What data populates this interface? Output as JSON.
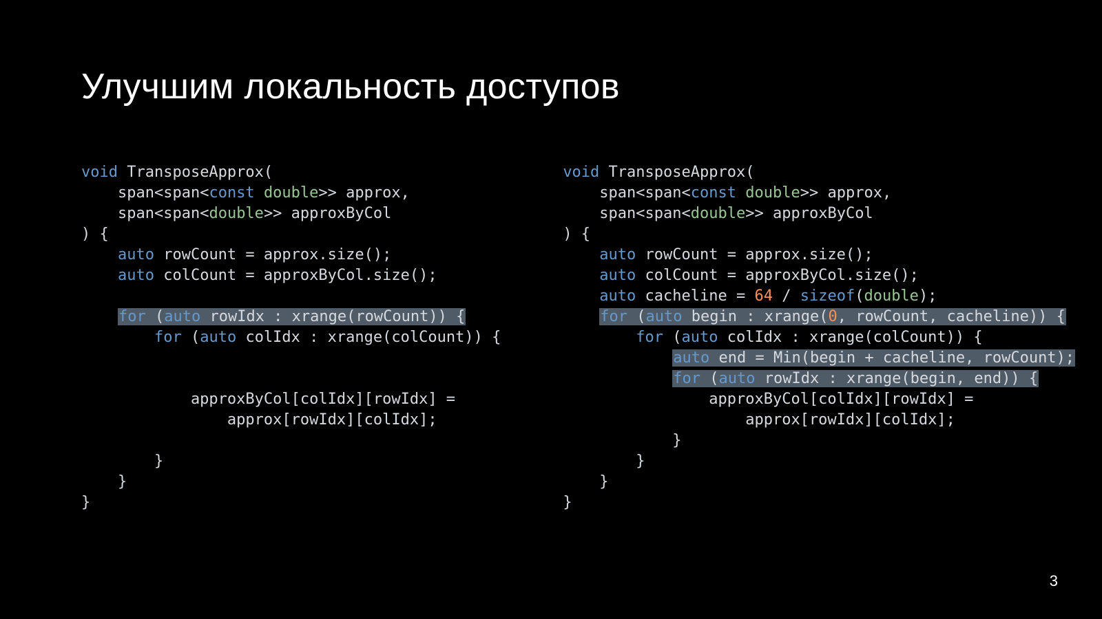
{
  "title": "Улучшим локальность доступов",
  "page_number": "3",
  "left_code": {
    "l1": {
      "a": "void",
      "b": " TransposeApprox("
    },
    "l2": {
      "a": "    span",
      "b": "<",
      "c": "span",
      "d": "<",
      "e": "const",
      "f": " ",
      "g": "double",
      "h": ">> approx,"
    },
    "l3": {
      "a": "    span",
      "b": "<",
      "c": "span",
      "d": "<",
      "e": "double",
      "f": ">> approxByCol"
    },
    "l4": ") {",
    "l5": {
      "a": "    ",
      "b": "auto",
      "c": " rowCount = approx.size();"
    },
    "l6": {
      "a": "    ",
      "b": "auto",
      "c": " colCount = approxByCol.size();"
    },
    "l7": "",
    "l8": {
      "a": "    ",
      "hl_b": "for",
      "hl_c": " (",
      "hl_d": "auto",
      "hl_e": " rowIdx : xrange(rowCount)) {"
    },
    "l9": {
      "a": "        ",
      "b": "for",
      "c": " (",
      "d": "auto",
      "e": " colIdx : xrange(colCount)) {"
    },
    "l10": "",
    "l11": "",
    "l12": "            approxByCol[colIdx][rowIdx] =",
    "l13": "                approx[rowIdx][colIdx];",
    "l14": "",
    "l15": "        }",
    "l16": "    }",
    "l17": "}"
  },
  "right_code": {
    "l1": {
      "a": "void",
      "b": " TransposeApprox("
    },
    "l2": {
      "a": "    span",
      "b": "<",
      "c": "span",
      "d": "<",
      "e": "const",
      "f": " ",
      "g": "double",
      "h": ">> approx,"
    },
    "l3": {
      "a": "    span",
      "b": "<",
      "c": "span",
      "d": "<",
      "e": "double",
      "f": ">> approxByCol"
    },
    "l4": ") {",
    "l5": {
      "a": "    ",
      "b": "auto",
      "c": " rowCount = approx.size();"
    },
    "l6": {
      "a": "    ",
      "b": "auto",
      "c": " colCount = approxByCol.size();"
    },
    "l7": {
      "a": "    ",
      "b": "auto",
      "c": " cacheline = ",
      "d": "64",
      "e": " / ",
      "f": "sizeof",
      "g": "(",
      "h": "double",
      "i": ");"
    },
    "l8": {
      "a": "    ",
      "hl_b": "for",
      "hl_c": " (",
      "hl_d": "auto",
      "hl_e": " begin : xrange(",
      "hl_f": "0",
      "hl_g": ", rowCount, cacheline)) {"
    },
    "l9": {
      "a": "        ",
      "b": "for",
      "c": " (",
      "d": "auto",
      "e": " colIdx : xrange(colCount)) {"
    },
    "l10": {
      "a": "            ",
      "hl_b": "auto",
      "hl_c": " end = Min(begin + cacheline, rowCount);"
    },
    "l11": {
      "a": "            ",
      "hl_b": "for",
      "hl_c": " (",
      "hl_d": "auto",
      "hl_e": " rowIdx : xrange(begin, end)) {"
    },
    "l12": "                approxByCol[colIdx][rowIdx] =",
    "l13": "                    approx[rowIdx][colIdx];",
    "l14": "            }",
    "l15": "        }",
    "l16": "    }",
    "l17": "}"
  }
}
